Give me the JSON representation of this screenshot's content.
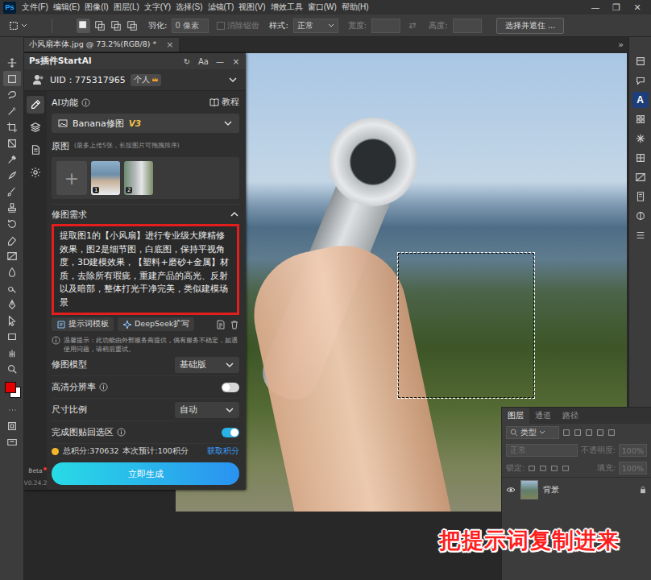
{
  "app_logo": "Ps",
  "menu_bar": {
    "items": [
      "文件(F)",
      "编辑(E)",
      "图像(I)",
      "图层(L)",
      "文字(Y)",
      "选择(S)",
      "滤镜(T)",
      "视图(V)",
      "增效工具",
      "窗口(W)",
      "帮助(H)"
    ],
    "window_controls": [
      "—",
      "❐",
      "✕"
    ]
  },
  "options_bar": {
    "selection_modes": [
      {
        "selected": true
      },
      {
        "selected": false
      },
      {
        "selected": false
      },
      {
        "selected": false
      }
    ],
    "feather_label": "羽化:",
    "feather_value": "0 像素",
    "antialias": {
      "label": "消除锯齿",
      "disabled": true,
      "checked": false
    },
    "style_label": "样式:",
    "style_value": "正常",
    "width_label": "宽度:",
    "swap": "⇄",
    "height_label": "高度:",
    "mask_button": "选择并遮住 ..."
  },
  "document_tab": {
    "title": "小风扇本体.jpg @ 73.2%(RGB/8) *",
    "close": "×",
    "overflow": "»"
  },
  "toolbar": {
    "tools": [
      {
        "selected": false
      },
      {
        "selected": true
      },
      {
        "selected": false
      },
      {
        "selected": false
      },
      {
        "selected": false
      },
      {
        "selected": false
      },
      {
        "selected": false
      },
      {
        "selected": false
      },
      {
        "selected": false
      },
      {
        "selected": false
      },
      {
        "selected": false
      },
      {
        "selected": false
      },
      {
        "selected": false
      },
      {
        "selected": false
      },
      {
        "selected": false
      },
      {
        "selected": false
      },
      {
        "selected": false
      },
      {
        "selected": false
      },
      {
        "selected": false
      },
      {
        "selected": false
      }
    ],
    "swatches": [
      {
        "color": "#e50000"
      },
      {
        "color": "#ffffff"
      }
    ],
    "bottom_tools": [
      {
        "selected": false
      },
      {
        "selected": false
      },
      {
        "selected": false
      }
    ]
  },
  "right_dock": {
    "items": [
      {
        "label": "",
        "selected": false
      },
      {
        "label": "",
        "selected": false
      },
      {
        "label": "A",
        "selected": true
      },
      {
        "label": "",
        "selected": false
      },
      {
        "label": "",
        "selected": false
      },
      {
        "label": "",
        "selected": false
      },
      {
        "label": "",
        "selected": false
      },
      {
        "label": "",
        "selected": false
      },
      {
        "label": "",
        "selected": false
      },
      {
        "label": "",
        "selected": false
      }
    ]
  },
  "canvas": {
    "selection": true
  },
  "plugin": {
    "title": "Ps插件StartAI",
    "header_buttons": [
      "↻",
      "Aa",
      "—",
      "×"
    ],
    "uid": "UID：775317965",
    "account_badge": "个人",
    "nav": [
      {
        "selected": true
      },
      {
        "selected": false
      },
      {
        "selected": false
      },
      {
        "selected": false
      }
    ],
    "beta": "Beta",
    "version": "V0.24.2",
    "ai_function": {
      "label": "AI功能",
      "tutorial": "教程",
      "value": "Banana修图",
      "version_tag": "V3"
    },
    "source": {
      "label": "原图",
      "note": "(最多上传5张，长按图片可拖拽排序)",
      "add": "+",
      "images": [
        {
          "index": "1"
        },
        {
          "index": "2"
        }
      ]
    },
    "prompt": {
      "label": "修图需求",
      "expanded": true,
      "highlighted": true,
      "text": "提取图1的【小风扇】进行专业级大牌精修效果，图2是细节图，白底图，保持平视角度，3D建模效果，【塑料+磨砂+金属】材质，去除所有瑕疵，重建产品的高光、反射以及暗部，整体打光干净完美，类似建模场景"
    },
    "prompt_actions": [
      "提示词模板",
      "DeepSeek扩写"
    ],
    "notice": "温馨提示：此功能由外部服务商提供，偶有服务不稳定，如遇使用问题，请稍后重试。",
    "settings": [
      {
        "kind": "select",
        "label": "修图模型",
        "info": false,
        "value": "基础版"
      },
      {
        "kind": "toggle",
        "label": "高清分辨率",
        "info": true,
        "on": false
      },
      {
        "kind": "select",
        "label": "尺寸比例",
        "info": false,
        "value": "自动"
      },
      {
        "kind": "toggle",
        "label": "完成图贴回选区",
        "info": true,
        "on": true
      }
    ],
    "points": {
      "total": "总积分:370632",
      "estimate": "本次预计:100积分",
      "get": "获取积分"
    },
    "generate": "立即生成"
  },
  "layers_panel": {
    "tabs": [
      {
        "label": "图层",
        "selected": true
      },
      {
        "label": "通道",
        "selected": false
      },
      {
        "label": "路径",
        "selected": false
      }
    ],
    "filter": "类型",
    "adjustments_disabled": true,
    "blend_mode": "正常",
    "opacity_label": "不透明度:",
    "opacity": "100%",
    "lock_label": "锁定:",
    "fill_label": "填充:",
    "fill": "100%",
    "layers": [
      {
        "name": "背景",
        "visible": true,
        "locked": true,
        "selected": false
      }
    ]
  },
  "caption": "把提示词复制进来"
}
